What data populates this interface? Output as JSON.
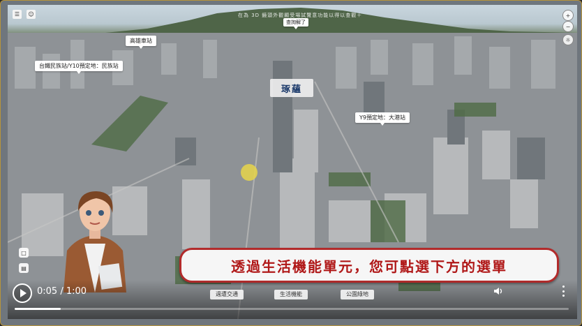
{
  "scene": {
    "top_caption": "在為 3D 鏡頭外觀顯受場試覽意功能以得以查觀＋",
    "top_button": "查詢解了",
    "brand_label": "琢蘊",
    "location_tags": [
      {
        "id": "kaohsiung-station",
        "label": "高雄車站"
      },
      {
        "id": "minzu-station",
        "label": "台鐵民族站/Y10預定地：民族站"
      },
      {
        "id": "dagang-station",
        "label": "Y9預定地：大港站"
      }
    ],
    "subtitle": "透過生活機能單元，您可點選下方的選單",
    "bottom_menu": [
      "週遭交通",
      "生活機能",
      "公園綠地"
    ]
  },
  "player": {
    "current_time": "0:05",
    "separator": "/",
    "duration": "1:00",
    "progress_fraction": 0.083,
    "icons": [
      "menu-icon",
      "person-icon",
      "zoom-in-icon",
      "zoom-out-icon",
      "sun-icon",
      "play-icon",
      "volume-icon",
      "more-icon",
      "chat-icon",
      "text-icon"
    ]
  },
  "colors": {
    "subtitle_border": "#b22b2b",
    "subtitle_text": "#b01818",
    "frame_border": "#b8943a"
  }
}
